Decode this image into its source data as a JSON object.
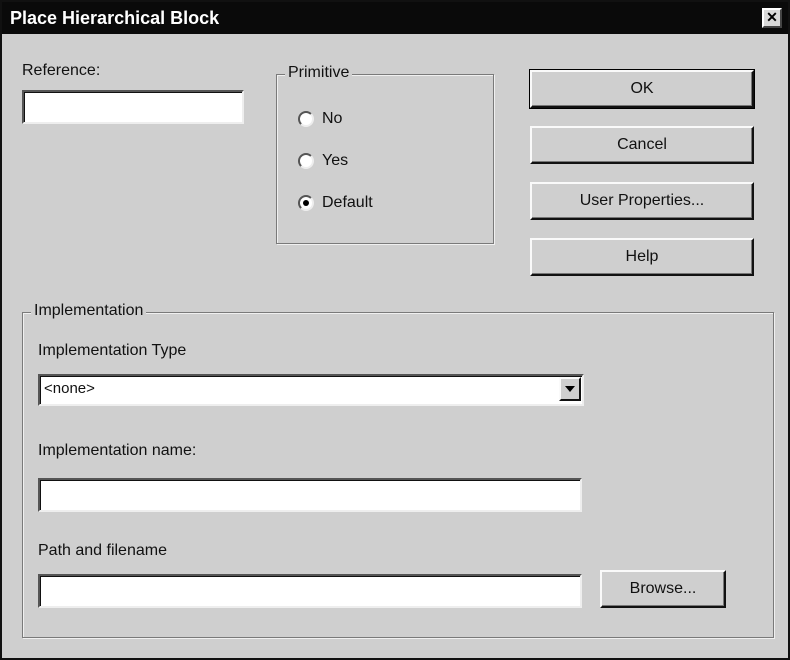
{
  "dialog": {
    "title": "Place Hierarchical Block",
    "close_icon": "close-icon"
  },
  "reference": {
    "label": "Reference:",
    "value": ""
  },
  "primitive": {
    "legend": "Primitive",
    "options": [
      {
        "label": "No",
        "checked": false
      },
      {
        "label": "Yes",
        "checked": false
      },
      {
        "label": "Default",
        "checked": true
      }
    ]
  },
  "buttons": {
    "ok": "OK",
    "cancel": "Cancel",
    "user_properties": "User Properties...",
    "help": "Help",
    "browse": "Browse..."
  },
  "implementation": {
    "legend": "Implementation",
    "type_label": "Implementation Type",
    "type_value": "<none>",
    "name_label": "Implementation name:",
    "name_value": "",
    "path_label": "Path and filename",
    "path_value": ""
  }
}
